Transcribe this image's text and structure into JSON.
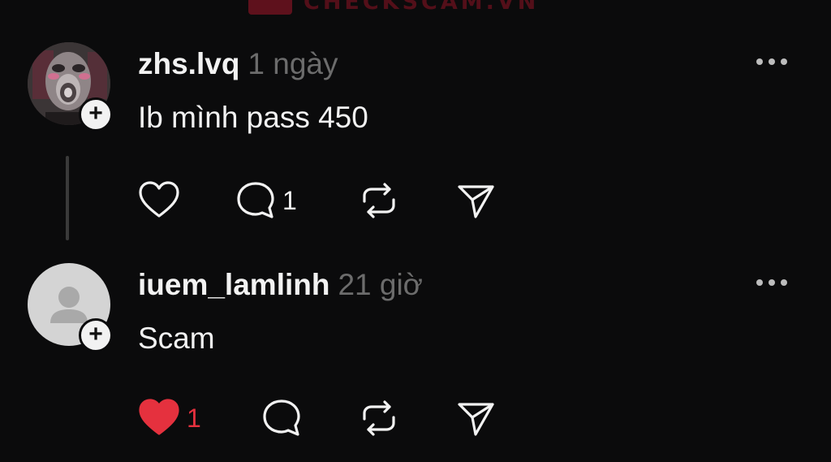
{
  "watermark": {
    "text": "CHECKSCAM.VN"
  },
  "posts": [
    {
      "username": "zhs.lvq",
      "time": "1 ngày",
      "text": "Ib mình pass 450",
      "avatar": "photo-avatar",
      "liked": false,
      "like_count": "",
      "reply_count": "1"
    },
    {
      "username": "iuem_lamlinh",
      "time": "21 giờ",
      "text": "Scam",
      "avatar": "default-avatar",
      "liked": true,
      "like_count": "1",
      "reply_count": ""
    }
  ],
  "icons": {
    "follow": "plus-icon",
    "more": "more-horizontal-icon",
    "like": "heart-icon",
    "reply": "comment-icon",
    "repost": "repost-icon",
    "share": "send-icon"
  },
  "colors": {
    "background": "#0b0b0c",
    "text": "#f2f2f2",
    "muted": "#6c6c6c",
    "liked": "#e5313e",
    "watermark": "#8e1425"
  }
}
